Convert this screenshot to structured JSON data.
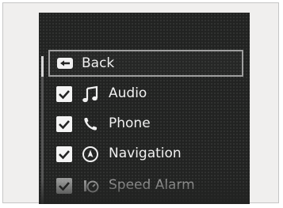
{
  "menu": {
    "back_label": "Back",
    "items": [
      {
        "label": "Audio",
        "checked": true,
        "icon": "music-note-icon"
      },
      {
        "label": "Phone",
        "checked": true,
        "icon": "phone-icon"
      },
      {
        "label": "Navigation",
        "checked": true,
        "icon": "navigation-icon"
      },
      {
        "label": "Speed Alarm",
        "checked": true,
        "icon": "speed-alarm-icon"
      }
    ]
  }
}
